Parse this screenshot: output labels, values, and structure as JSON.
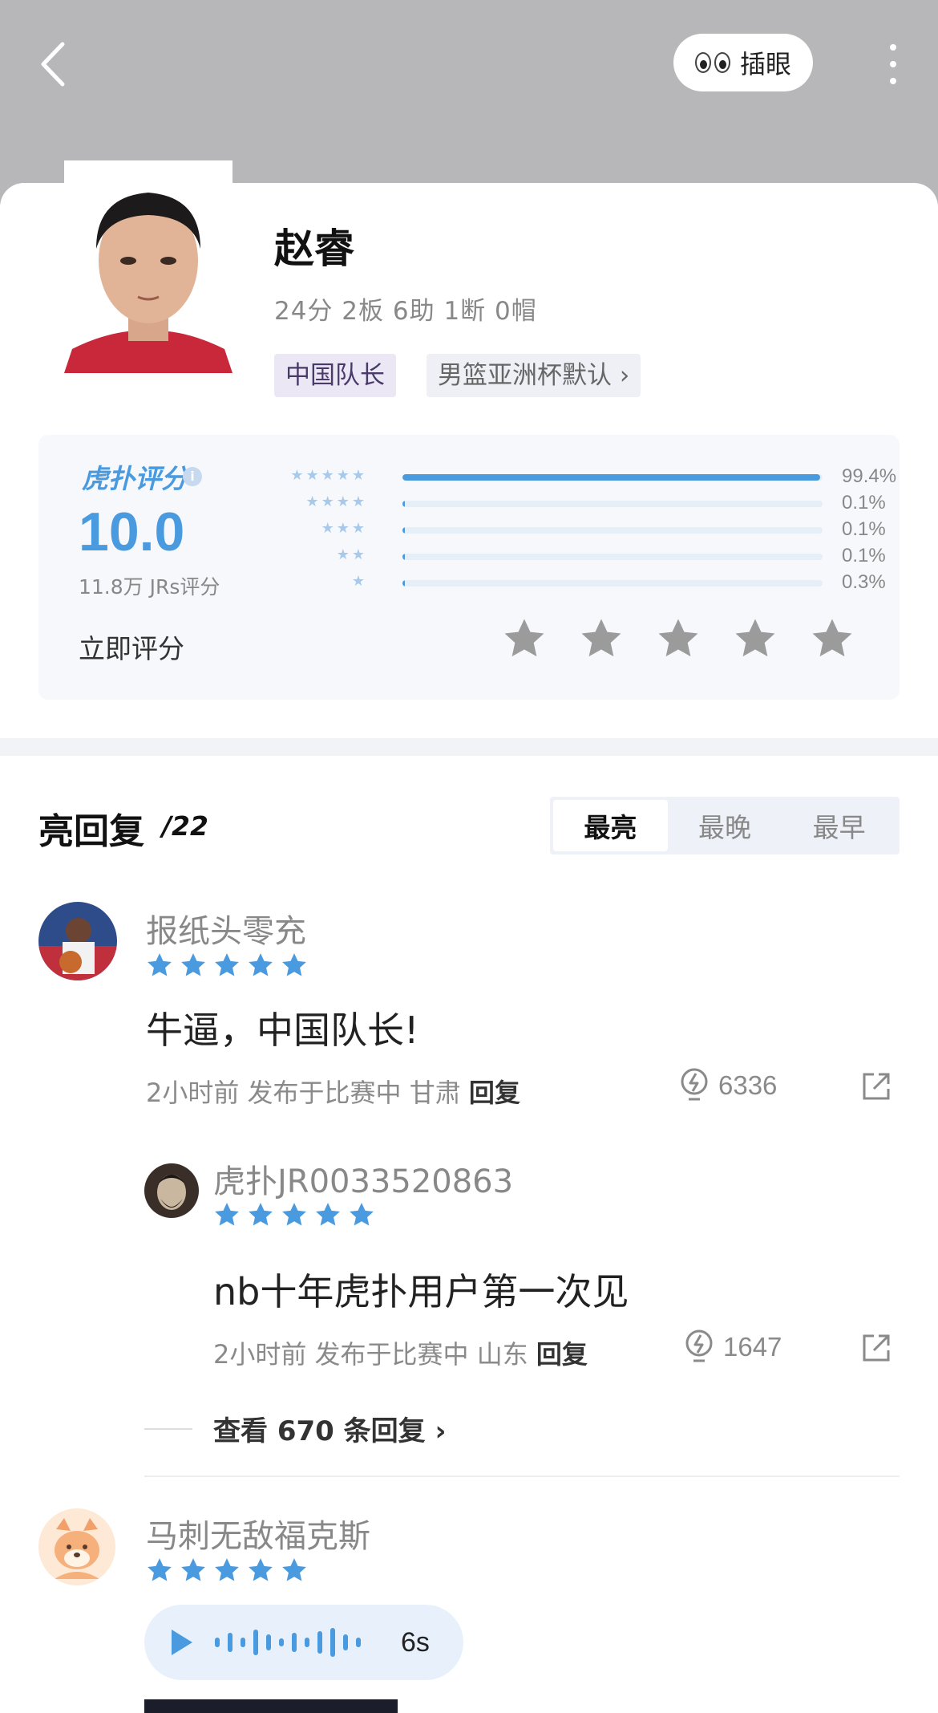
{
  "header": {
    "peek_label": "插眼"
  },
  "player": {
    "name": "赵睿",
    "stats": "24分 2板 6助 1断 0帽",
    "tags": [
      "中国队长",
      "男篮亚洲杯默认 ›"
    ]
  },
  "rating": {
    "brand": "虎扑评分",
    "registered": "®",
    "score": "10.0",
    "count_label": "11.8万 JRs评分",
    "distribution": [
      {
        "stars": "★★★★★",
        "percent_label": "99.4%",
        "value": 99.4
      },
      {
        "stars": "★★★★",
        "percent_label": "0.1%",
        "value": 0.1
      },
      {
        "stars": "★★★",
        "percent_label": "0.1%",
        "value": 0.1
      },
      {
        "stars": "★★",
        "percent_label": "0.1%",
        "value": 0.1
      },
      {
        "stars": "★",
        "percent_label": "0.3%",
        "value": 0.3
      }
    ],
    "rate_now_label": "立即评分"
  },
  "replies": {
    "title": "亮回复",
    "count": "/22",
    "sort_tabs": [
      "最亮",
      "最晚",
      "最早"
    ],
    "active_tab": "最亮",
    "items": [
      {
        "user": "报纸头零充",
        "stars": 5,
        "text": "牛逼，中国队长!",
        "time": "2小时前 发布于比赛中 甘肃",
        "reply_label": "回复",
        "likes": "6336"
      },
      {
        "user": "虎扑JR0033520863",
        "stars": 5,
        "text": "nb十年虎扑用户第一次见",
        "time": "2小时前 发布于比赛中 山东",
        "reply_label": "回复",
        "likes": "1647"
      },
      {
        "user": "马刺无敌福克斯",
        "stars": 5,
        "voice_duration": "6s"
      }
    ],
    "view_more": "查看 670 条回复 ›"
  },
  "colors": {
    "accent": "#4a9adf",
    "header_bg": "#b7b7b9",
    "star_gray": "#9b9b9b"
  }
}
